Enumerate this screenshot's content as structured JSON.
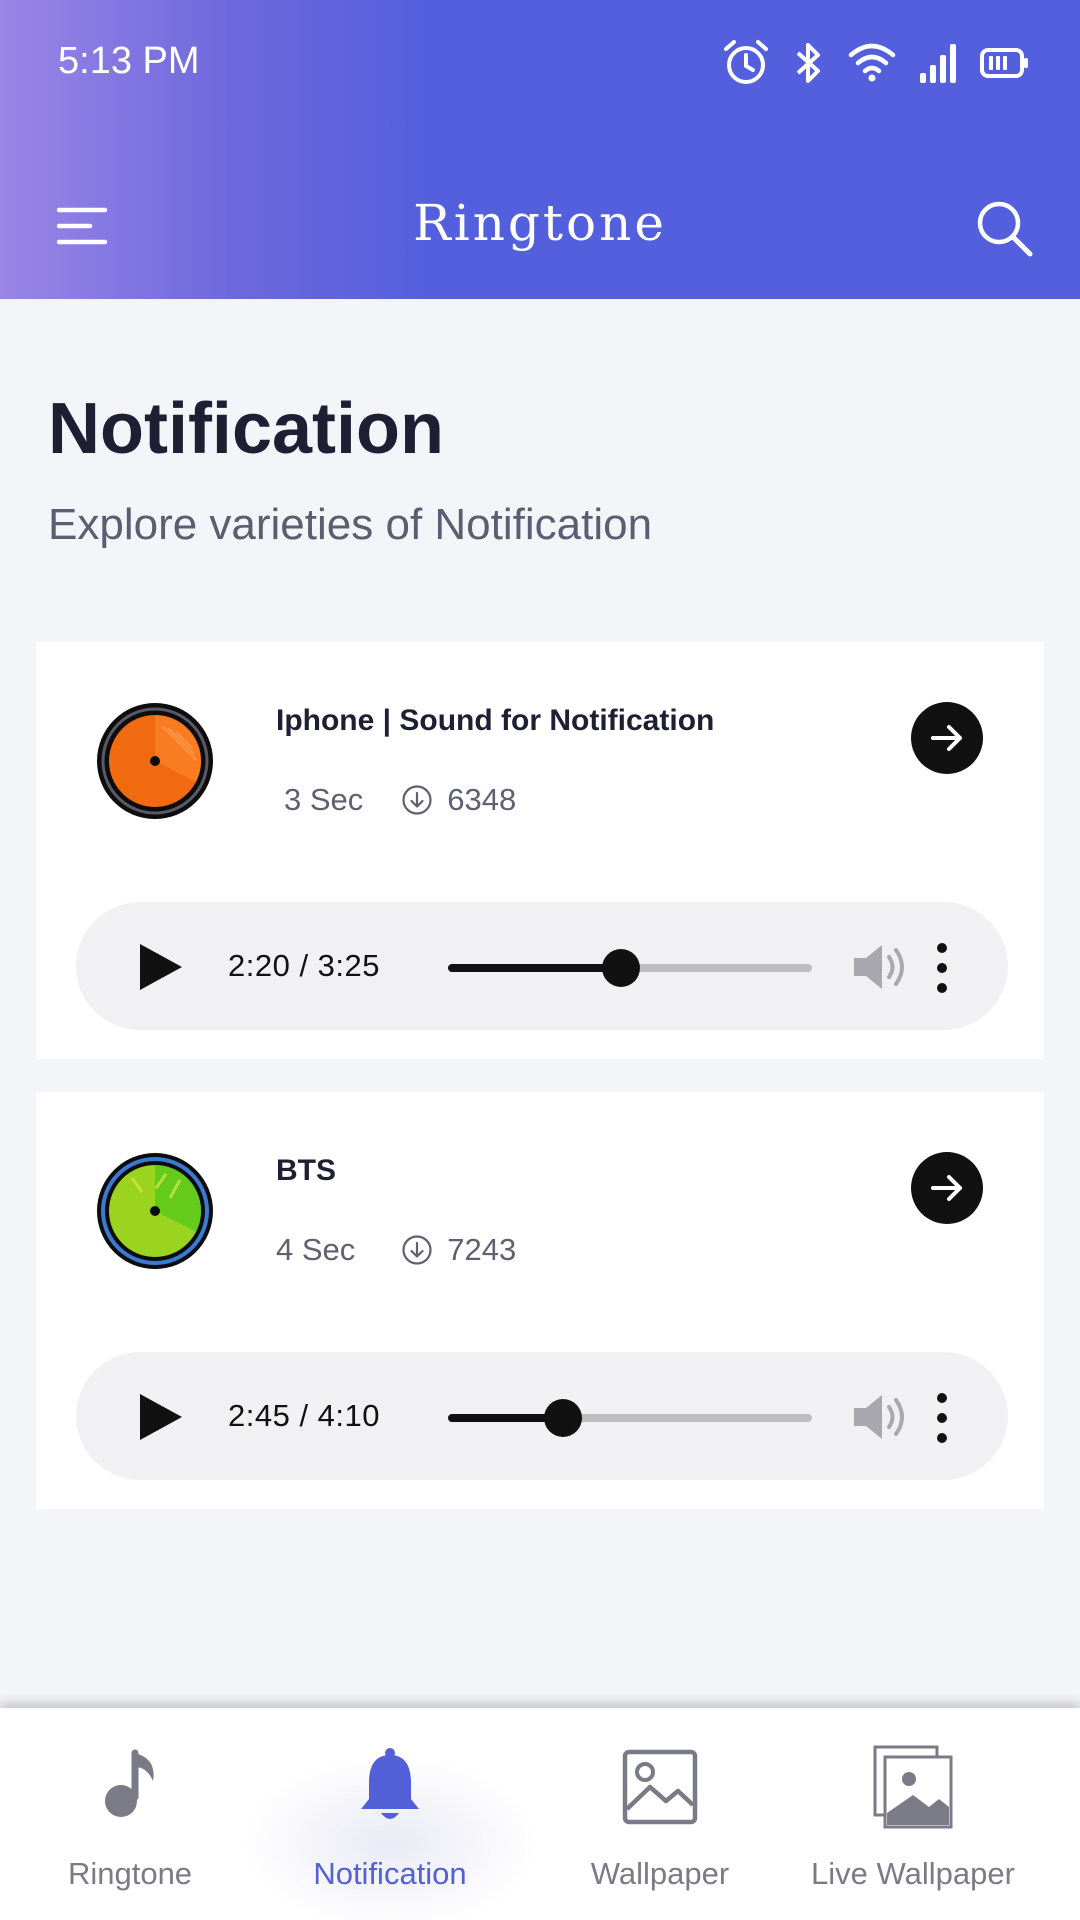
{
  "status_bar": {
    "time": "5:13 PM",
    "icons": [
      "alarm-icon",
      "bluetooth-icon",
      "wifi-icon",
      "signal-icon",
      "battery-icon"
    ]
  },
  "app_bar": {
    "title": "Ringtone",
    "menu_icon": "hamburger-menu-icon",
    "search_icon": "search-icon"
  },
  "page": {
    "title": "Notification",
    "subtitle": "Explore varieties of Notification"
  },
  "cards": [
    {
      "title": "Iphone | Sound for Notification",
      "duration": "3 Sec",
      "downloads": "6348",
      "disc_color": "#f26a10",
      "player": {
        "time": "2:20 / 3:25",
        "progress": 0.476
      }
    },
    {
      "title": "BTS",
      "duration": "4 Sec",
      "downloads": "7243",
      "disc_color": "#9bd41e",
      "player": {
        "time": "2:45 / 4:10",
        "progress": 0.316
      }
    }
  ],
  "bottom_nav": {
    "items": [
      {
        "label": "Ringtone",
        "icon": "music-note-icon",
        "active": false
      },
      {
        "label": "Notification",
        "icon": "bell-icon",
        "active": true
      },
      {
        "label": "Wallpaper",
        "icon": "image-icon",
        "active": false
      },
      {
        "label": "Live Wallpaper",
        "icon": "images-stack-icon",
        "active": false
      }
    ]
  },
  "colors": {
    "accent": "#5360d8",
    "header_gradient_start": "#9a85e6",
    "header_gradient_end": "#535fdd"
  }
}
